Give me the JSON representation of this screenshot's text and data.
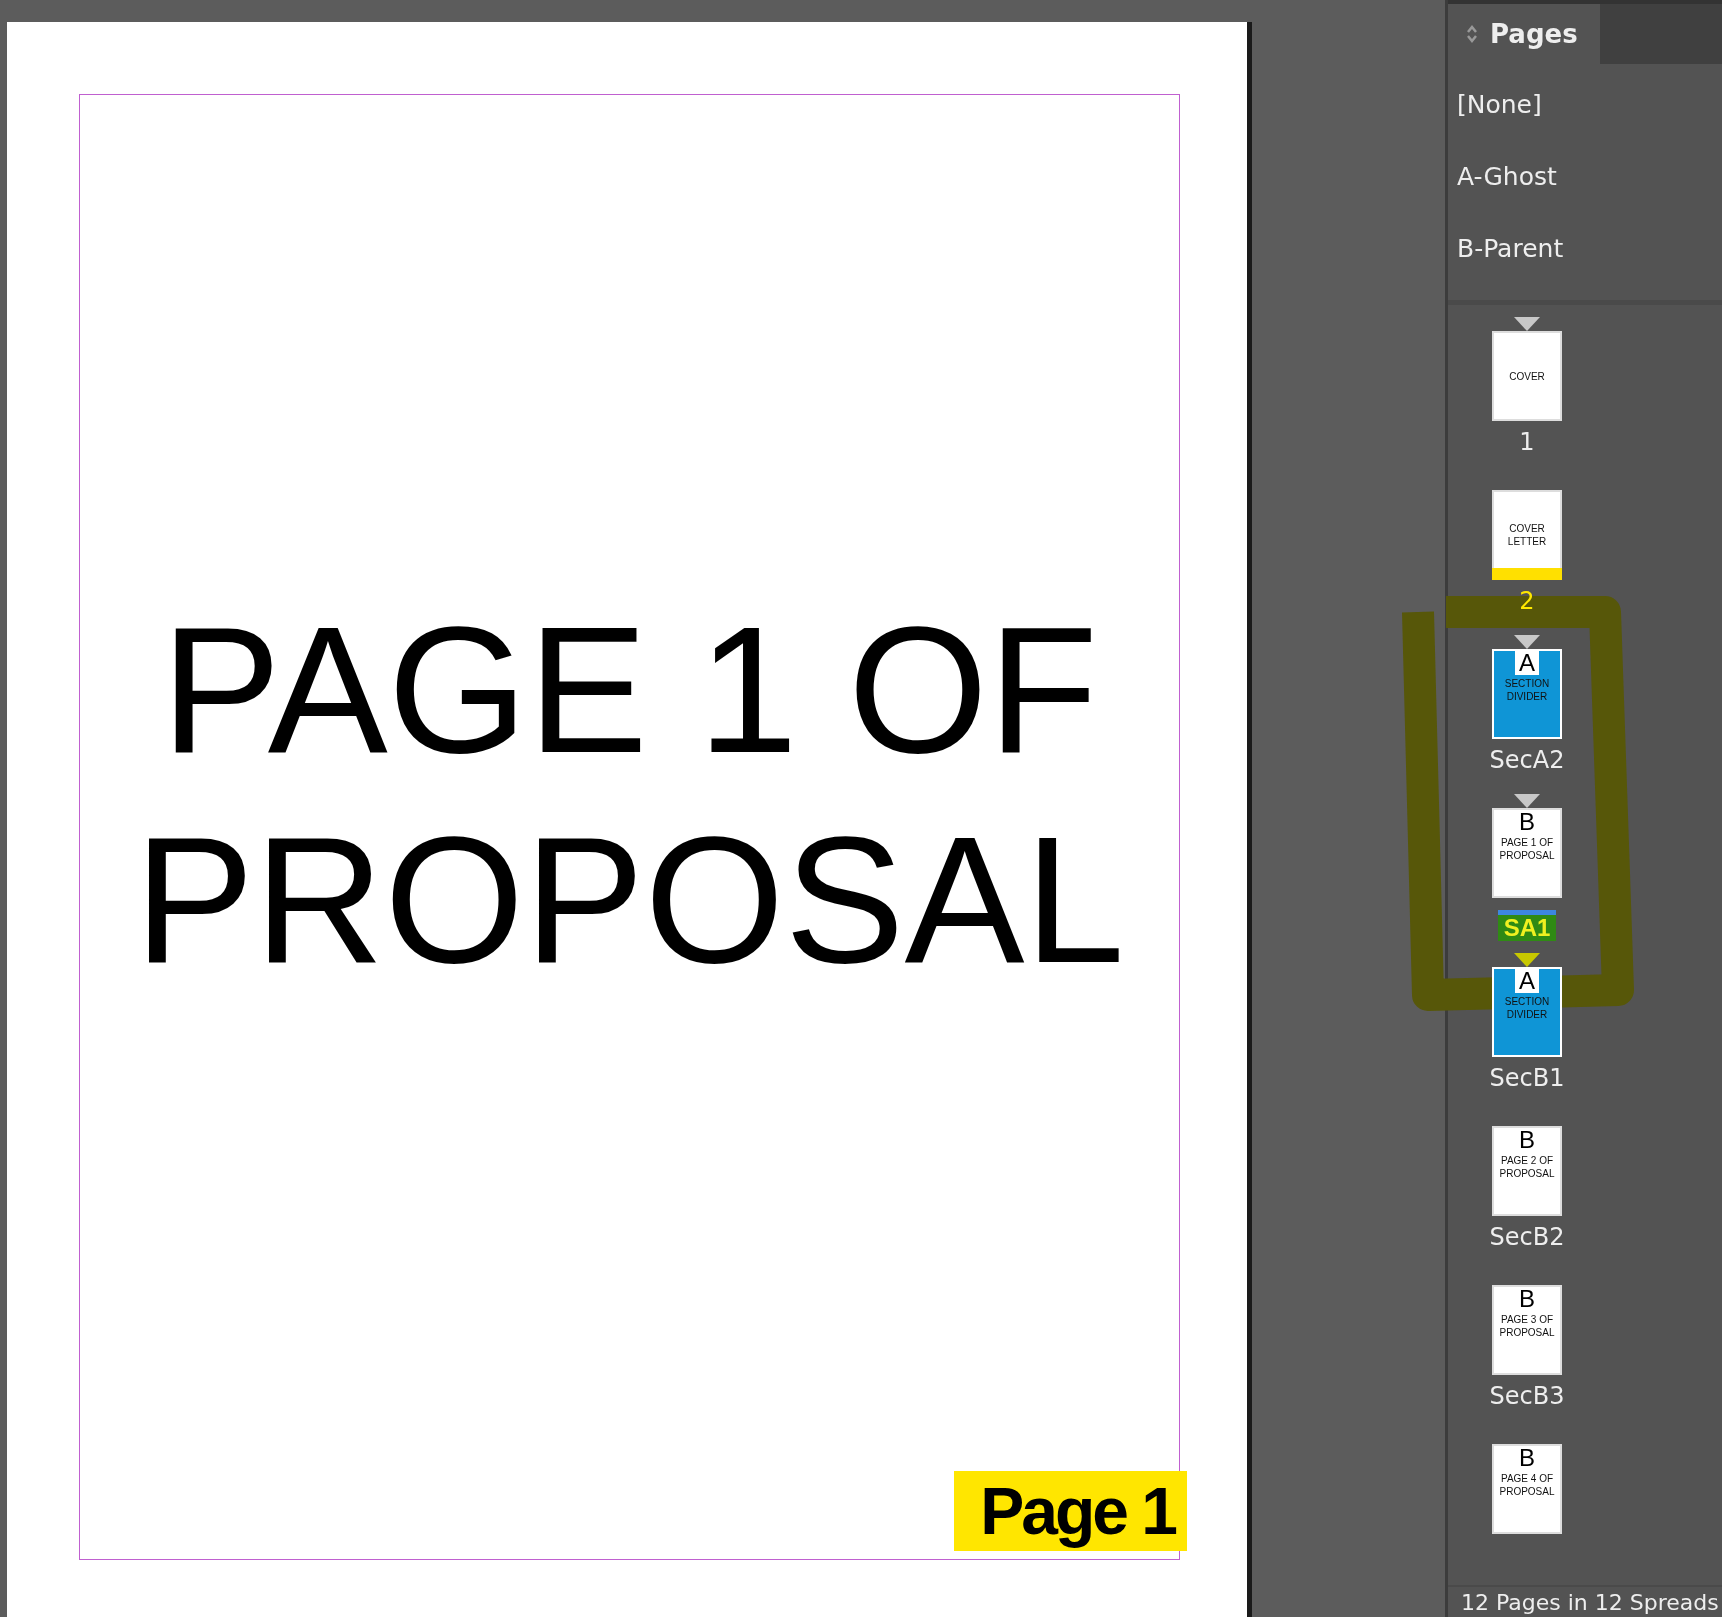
{
  "document": {
    "heading": "PAGE 1 OF PROPOSAL",
    "folio": "Page 1"
  },
  "panel": {
    "title": "Pages",
    "parents": [
      "[None]",
      "A-Ghost",
      "B-Parent"
    ],
    "pages": [
      {
        "lines": [
          "COVER"
        ],
        "color": "#ffffff",
        "section_start": true,
        "marker_highlighted": false,
        "label": "1",
        "selected": false,
        "label_highlighted": false
      },
      {
        "lines": [
          "COVER",
          "LETTER"
        ],
        "color": "#ffffff",
        "section_start": false,
        "label": "2",
        "selected": true,
        "label_highlighted": false
      },
      {
        "parent": "A",
        "lines": [
          "SECTION",
          "DIVIDER"
        ],
        "color": "#0f95d6",
        "section_start": true,
        "marker_highlighted": false,
        "label": "SecA2",
        "selected": false,
        "label_highlighted": false
      },
      {
        "parent": "B",
        "lines": [
          "PAGE 1 OF",
          "PROPOSAL"
        ],
        "color": "#ffffff",
        "section_start": true,
        "marker_highlighted": false,
        "label": "SA1",
        "selected": false,
        "label_highlighted": true
      },
      {
        "parent": "A",
        "lines": [
          "SECTION",
          "DIVIDER"
        ],
        "color": "#0f95d6",
        "section_start": true,
        "marker_highlighted": true,
        "label": "SecB1",
        "selected": false,
        "label_highlighted": false
      },
      {
        "parent": "B",
        "lines": [
          "PAGE 2 OF",
          "PROPOSAL"
        ],
        "color": "#ffffff",
        "section_start": false,
        "label": "SecB2",
        "selected": false,
        "label_highlighted": false
      },
      {
        "parent": "B",
        "lines": [
          "PAGE 3 OF",
          "PROPOSAL"
        ],
        "color": "#ffffff",
        "section_start": false,
        "label": "SecB3",
        "selected": false,
        "label_highlighted": false
      },
      {
        "parent": "B",
        "lines": [
          "PAGE 4 OF",
          "PROPOSAL"
        ],
        "color": "#ffffff",
        "section_start": false,
        "selected": false
      }
    ],
    "status": "12 Pages in 12 Spreads"
  }
}
